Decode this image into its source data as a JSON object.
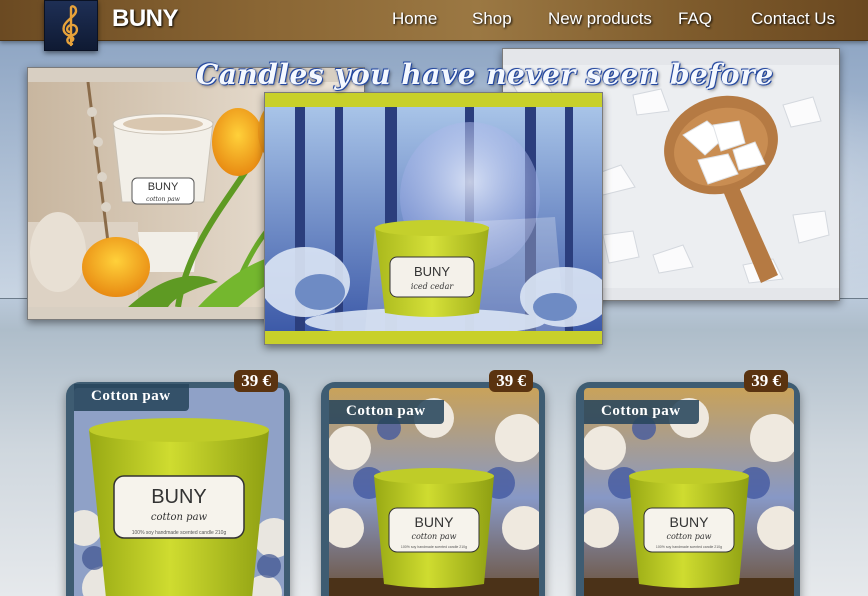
{
  "header": {
    "brand": "BUNY",
    "logo_icon": "treble-clef-logo-icon",
    "nav": [
      {
        "label": "Home"
      },
      {
        "label": "Shop"
      },
      {
        "label": "New products"
      },
      {
        "label": "FAQ"
      },
      {
        "label": "Contact Us"
      }
    ]
  },
  "banner": {
    "tagline": "Candles you have never seen before",
    "photos": [
      {
        "label_brand": "BUNY",
        "label_name": "cotton paw"
      },
      {
        "label_brand": "BUNY",
        "label_name": "iced cedar"
      },
      {
        "label_brand": "",
        "label_name": ""
      }
    ]
  },
  "products": [
    {
      "name": "Cotton paw",
      "price": "39 €",
      "label_brand": "BUNY",
      "label_name": "cotton paw",
      "label_small": "100% soy handmade scented candle 210g"
    },
    {
      "name": "Cotton paw",
      "price": "39 €",
      "label_brand": "BUNY",
      "label_name": "cotton paw",
      "label_small": "100% soy handmade scented candle 210g"
    },
    {
      "name": "Cotton paw",
      "price": "39 €",
      "label_brand": "BUNY",
      "label_name": "cotton paw",
      "label_small": "100% soy handmade scented candle 210g"
    }
  ],
  "colors": {
    "header": "#8a6634",
    "card": "#3e5c72",
    "price_badge": "#5a3310",
    "candle": "#c7d62c"
  }
}
